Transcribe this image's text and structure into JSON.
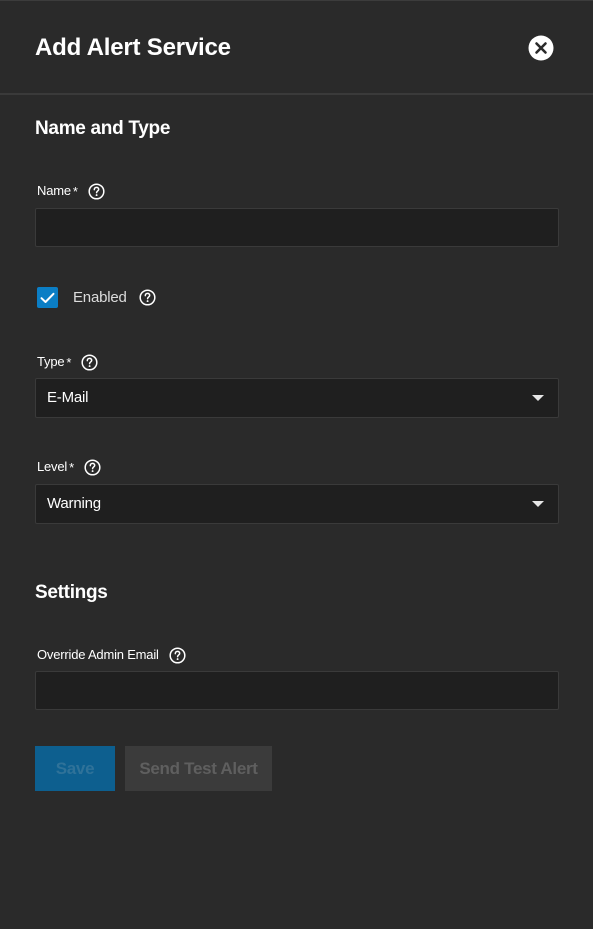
{
  "dialog": {
    "title": "Add Alert Service",
    "close_icon": "close-circle-icon"
  },
  "sections": {
    "name_and_type": "Name and Type",
    "settings": "Settings"
  },
  "fields": {
    "name": {
      "label": "Name",
      "required_marker": "*",
      "value": "",
      "placeholder": ""
    },
    "enabled": {
      "label": "Enabled",
      "checked": true
    },
    "type": {
      "label": "Type",
      "required_marker": "*",
      "value": "E-Mail"
    },
    "level": {
      "label": "Level",
      "required_marker": "*",
      "value": "Warning"
    },
    "override_admin_email": {
      "label": "Override Admin Email",
      "value": "",
      "placeholder": ""
    }
  },
  "buttons": {
    "save": "Save",
    "send_test_alert": "Send Test Alert"
  },
  "colors": {
    "background": "#2a2a2a",
    "input_background": "#1f1f1f",
    "accent": "#0b7ec5",
    "save_disabled": "#0d5f8f",
    "secondary_disabled": "#3b3b3b"
  }
}
